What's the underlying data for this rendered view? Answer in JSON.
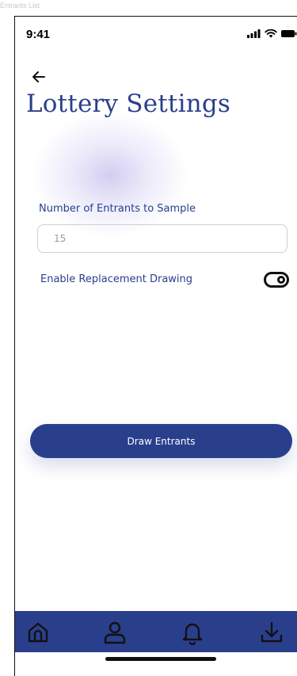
{
  "frame": {
    "label": "Entrants List"
  },
  "status_bar": {
    "time": "9:41"
  },
  "header": {
    "title": "Lottery Settings"
  },
  "form": {
    "sample_label": "Number of Entrants to Sample",
    "sample_value": "15",
    "replacement_label": "Enable Replacement Drawing",
    "replacement_enabled": true
  },
  "actions": {
    "draw_label": "Draw Entrants"
  },
  "nav": {
    "items": [
      {
        "icon": "home-icon"
      },
      {
        "icon": "profile-icon"
      },
      {
        "icon": "bell-icon"
      },
      {
        "icon": "download-icon"
      }
    ]
  },
  "colors": {
    "primary": "#2a3f8c",
    "background": "#ffffff",
    "input_border": "#cfcfcf"
  }
}
